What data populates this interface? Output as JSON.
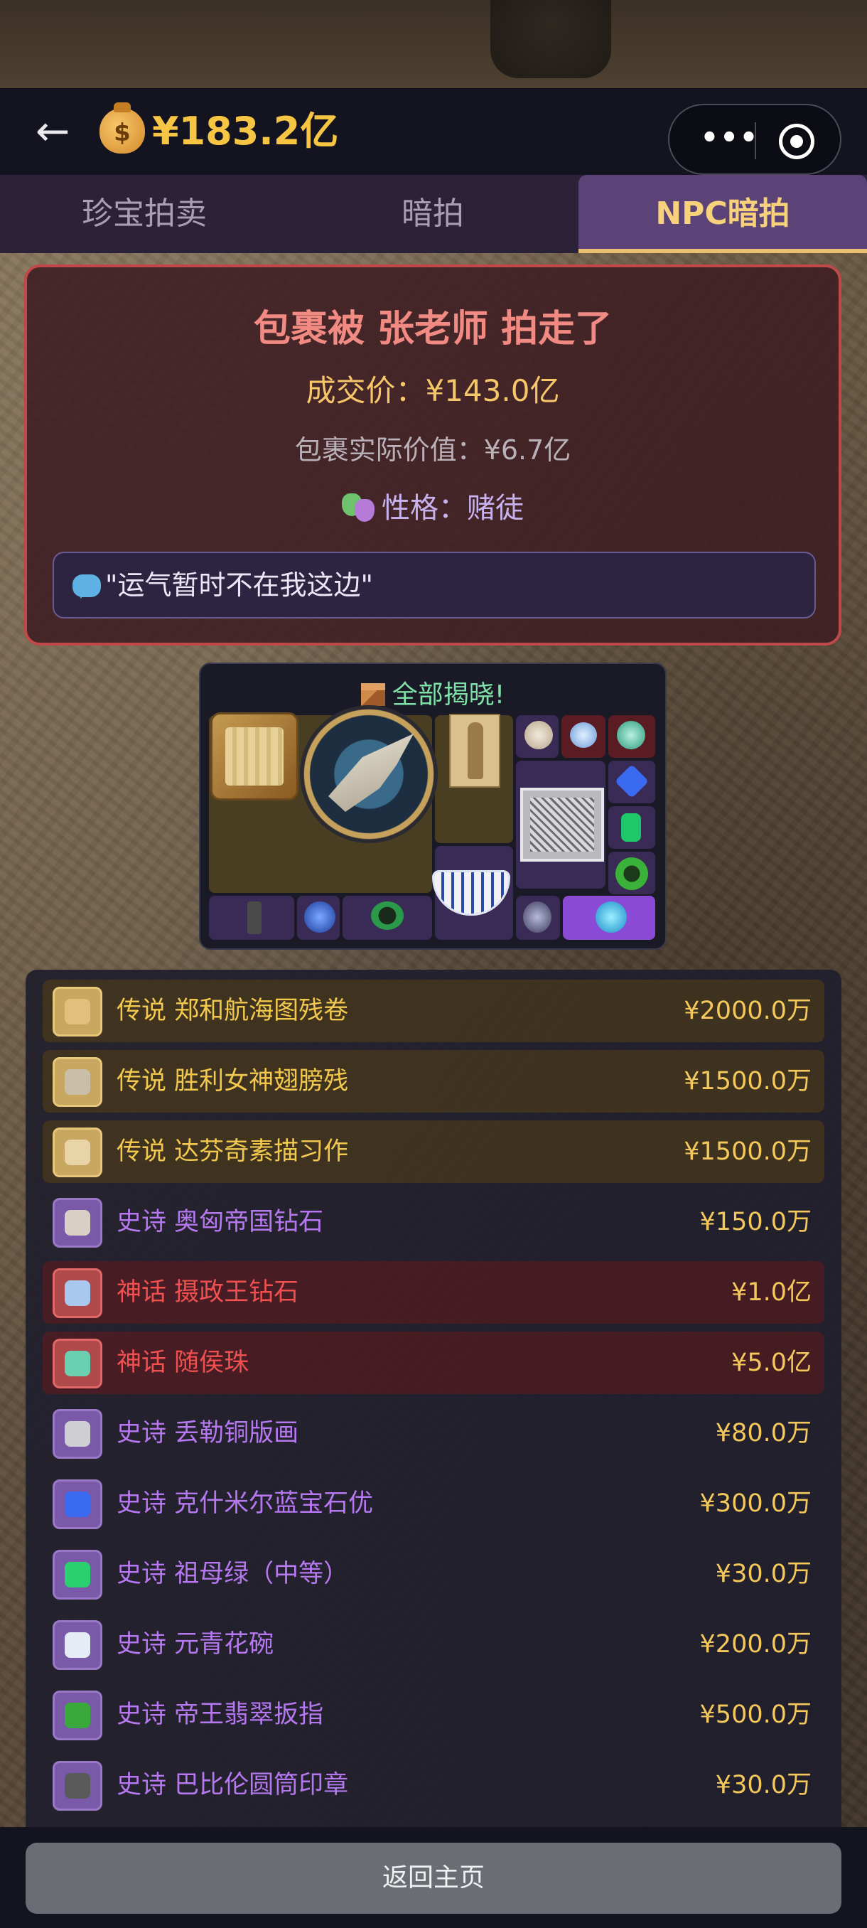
{
  "header": {
    "back_icon": "arrow-left-icon",
    "money_icon": "money-bag-icon",
    "balance": "¥183.2亿",
    "more_label": "•••",
    "target_icon": "record-icon"
  },
  "tabs": [
    {
      "label": "珍宝拍卖",
      "active": false
    },
    {
      "label": "暗拍",
      "active": false
    },
    {
      "label": "NPC暗拍",
      "active": true
    }
  ],
  "result": {
    "title": "包裹被 张老师 拍走了",
    "price": "成交价：¥143.0亿",
    "actual_value": "包裹实际价值：¥6.7亿",
    "personality": "性格：赌徒",
    "quote": "\"运气暂时不在我这边\""
  },
  "reveal": {
    "title": "全部揭晓!"
  },
  "items": [
    {
      "rarity": "legend",
      "name": "传说 郑和航海图残卷",
      "value": "¥2000.0万",
      "color": "#e0c07a"
    },
    {
      "rarity": "legend",
      "name": "传说 胜利女神翅膀残",
      "value": "¥1500.0万",
      "color": "#c9bfa8"
    },
    {
      "rarity": "legend",
      "name": "传说 达芬奇素描习作",
      "value": "¥1500.0万",
      "color": "#e8d4a6"
    },
    {
      "rarity": "epic",
      "name": "史诗 奥匈帝国钻石",
      "value": "¥150.0万",
      "color": "#d8d0c4"
    },
    {
      "rarity": "myth",
      "name": "神话 摄政王钻石",
      "value": "¥1.0亿",
      "color": "#a8c8f0"
    },
    {
      "rarity": "myth",
      "name": "神话 随侯珠",
      "value": "¥5.0亿",
      "color": "#6ad0b0"
    },
    {
      "rarity": "epic",
      "name": "史诗 丢勒铜版画",
      "value": "¥80.0万",
      "color": "#cfcfd3"
    },
    {
      "rarity": "epic",
      "name": "史诗 克什米尔蓝宝石优",
      "value": "¥300.0万",
      "color": "#3a6af0"
    },
    {
      "rarity": "epic",
      "name": "史诗 祖母绿（中等）",
      "value": "¥30.0万",
      "color": "#2ad070"
    },
    {
      "rarity": "epic",
      "name": "史诗 元青花碗",
      "value": "¥200.0万",
      "color": "#e6ecf6"
    },
    {
      "rarity": "epic",
      "name": "史诗 帝王翡翠扳指",
      "value": "¥500.0万",
      "color": "#3aa83a"
    },
    {
      "rarity": "epic",
      "name": "史诗 巴比伦圆筒印章",
      "value": "¥30.0万",
      "color": "#5a5a5a"
    }
  ],
  "footer": {
    "home_button": "返回主页"
  }
}
